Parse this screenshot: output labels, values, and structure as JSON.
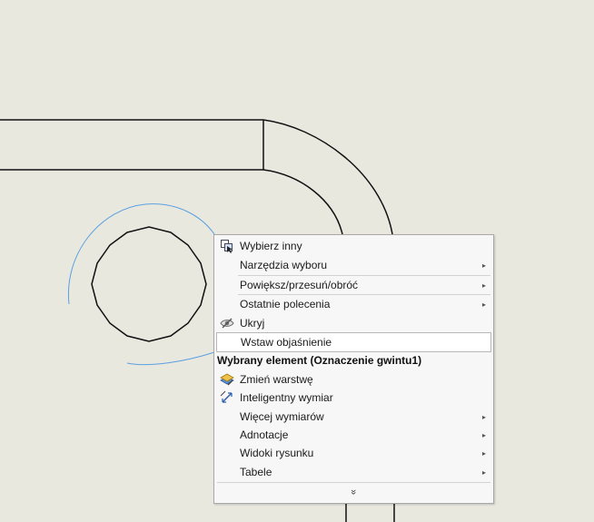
{
  "colors": {
    "background": "#e9e8df",
    "geometry": "#111111",
    "selection": "#5aa0e0",
    "menu_bg": "#f7f7f7"
  },
  "menu": {
    "items_top": [
      {
        "label": "Wybierz inny",
        "icon": "select-other-icon",
        "submenu": false
      },
      {
        "label": "Narzędzia wyboru",
        "icon": "",
        "submenu": true
      },
      {
        "label": "Powiększ/przesuń/obróć",
        "icon": "",
        "submenu": true
      },
      {
        "label": "Ostatnie polecenia",
        "icon": "",
        "submenu": true
      },
      {
        "label": "Ukryj",
        "icon": "eye-hide-icon",
        "submenu": false
      },
      {
        "label": "Wstaw objaśnienie",
        "icon": "",
        "submenu": false
      }
    ],
    "section_title": "Wybrany element (Oznaczenie gwintu1)",
    "items_bottom": [
      {
        "label": "Zmień warstwę",
        "icon": "layer-icon",
        "submenu": false
      },
      {
        "label": "Inteligentny wymiar",
        "icon": "smart-dimension-icon",
        "submenu": false
      },
      {
        "label": "Więcej wymiarów",
        "icon": "",
        "submenu": true
      },
      {
        "label": "Adnotacje",
        "icon": "",
        "submenu": true
      },
      {
        "label": "Widoki rysunku",
        "icon": "",
        "submenu": true
      },
      {
        "label": "Tabele",
        "icon": "",
        "submenu": true
      }
    ],
    "more_glyph": "»",
    "arrow_glyph": "▸"
  }
}
